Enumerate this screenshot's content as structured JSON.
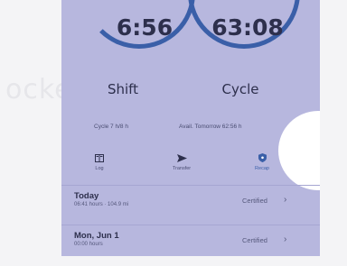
{
  "background_word": "ockerl",
  "gauges": {
    "shift": {
      "time": "6:56",
      "label": "Shift"
    },
    "cycle": {
      "time": "63:08",
      "label": "Cycle"
    }
  },
  "info": {
    "cycle": "Cycle 7 h/8 h",
    "available": "Avail. Tomorrow 62:56 h"
  },
  "nav": {
    "log": {
      "label": "Log",
      "icon": "book-icon"
    },
    "transfer": {
      "label": "Transfer",
      "icon": "send-icon"
    },
    "recap": {
      "label": "Recap",
      "icon": "shield-icon"
    }
  },
  "days": [
    {
      "date": "Today",
      "summary": "06:41 hours · 104.9 mi",
      "status": "Certified"
    },
    {
      "date": "Mon, Jun 1",
      "summary": "00:00 hours",
      "status": "Certified"
    }
  ],
  "colors": {
    "accent": "#3a5fa8",
    "panel": "#b7b7de",
    "text": "#2d2f4c"
  }
}
